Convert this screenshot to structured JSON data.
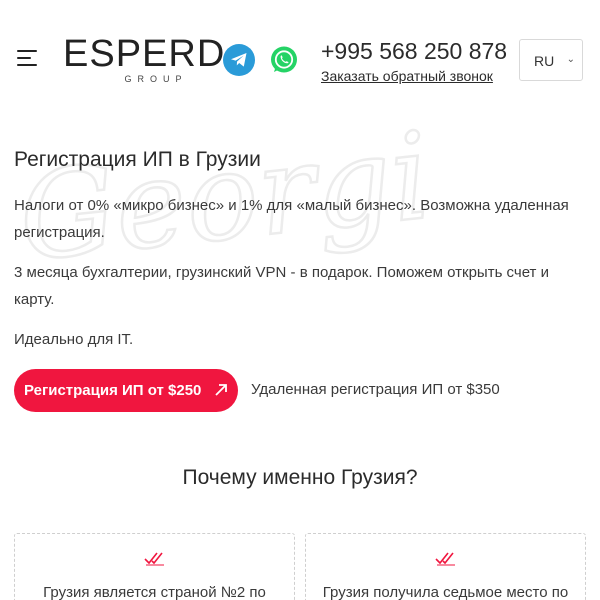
{
  "header": {
    "logo": {
      "word": "ESPERD",
      "group": "GROUP"
    },
    "phone": "+995 568 250 878",
    "callback_link": "Заказать обратный звонок",
    "language": {
      "selected": "RU"
    }
  },
  "hero": {
    "watermark_text": "Georgia",
    "title": "Регистрация ИП в Грузии",
    "paragraphs": [
      "Налоги от 0% «микро бизнес» и 1% для «малый бизнес». Возможна удаленная регистрация.",
      "3 месяца бухгалтерии, грузинский VPN - в подарок. Поможем открыть счет и карту.",
      "Идеально для IT."
    ],
    "cta_button": "Регистрация ИП от $250",
    "remote_link": "Удаленная регистрация ИП от $350"
  },
  "why": {
    "title": "Почему именно Грузия?",
    "cards": [
      {
        "text": "Грузия является страной №2 по"
      },
      {
        "text": "Грузия получила седьмое место по"
      }
    ]
  },
  "colors": {
    "accent": "#f0163f",
    "telegram": "#2a9bd8",
    "whatsapp": "#25d366"
  },
  "icons": [
    "menu-icon",
    "telegram-icon",
    "whatsapp-icon",
    "chevron-down-icon",
    "arrow-up-right-icon",
    "double-check-icon"
  ]
}
